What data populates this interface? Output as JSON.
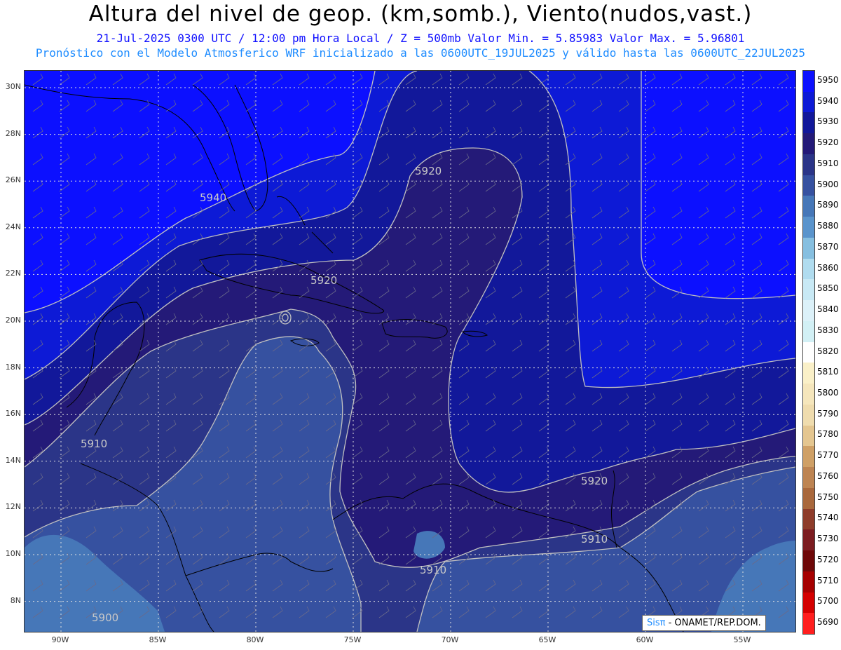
{
  "header": {
    "title": "Altura del nivel de geop. (km,somb.), Viento(nudos,vast.)",
    "subtitle": "21-Jul-2025  0300 UTC / 12:00 pm Hora Local / Z = 500mb   Valor Min. = 5.85983  Valor Max. = 5.96801",
    "forecast_note": "Pronóstico con el Modelo Atmosferico WRF inicializado a las 0600UTC_19JUL2025 y válido hasta las  0600UTC_22JUL2025"
  },
  "map": {
    "lat_labels": [
      "30N",
      "28N",
      "26N",
      "24N",
      "22N",
      "20N",
      "18N",
      "16N",
      "14N",
      "12N",
      "10N",
      "8N"
    ],
    "lon_labels": [
      "90W",
      "85W",
      "80W",
      "75W",
      "70W",
      "65W",
      "60W",
      "55W"
    ],
    "contour_labels": [
      "5940",
      "5920",
      "5920",
      "5920",
      "5910",
      "5910",
      "5910",
      "5900"
    ],
    "fill_colors": {
      "5950": "#0c10ff",
      "5940": "#0d1ad6",
      "5930": "#12189a",
      "5920": "#241a78",
      "5910": "#2b3588",
      "5900": "#3651a0",
      "5890": "#4677b8"
    }
  },
  "colorbar": {
    "levels": [
      "5950",
      "5940",
      "5930",
      "5920",
      "5910",
      "5900",
      "5890",
      "5880",
      "5870",
      "5860",
      "5850",
      "5840",
      "5830",
      "5820",
      "5810",
      "5800",
      "5790",
      "5780",
      "5770",
      "5760",
      "5750",
      "5740",
      "5730",
      "5720",
      "5710",
      "5700",
      "5690"
    ],
    "colors": [
      "#0c10ff",
      "#0d1ad6",
      "#12189a",
      "#241a78",
      "#2b3588",
      "#3651a0",
      "#4677b8",
      "#5a94cc",
      "#86bfe0",
      "#b0dcef",
      "#c8e9f5",
      "#dcf1f9",
      "#d2f0f5",
      "#ffffff",
      "#faf0c8",
      "#f5e6bc",
      "#efdcae",
      "#e4c690",
      "#cfa066",
      "#bd8452",
      "#a9683c",
      "#8e3c2a",
      "#7c1c20",
      "#6e0808",
      "#a60000",
      "#d40000",
      "#ff1e1e"
    ]
  },
  "logo": {
    "sis": "Sisπ",
    "org": "- ONAMET/REP.DOM."
  }
}
